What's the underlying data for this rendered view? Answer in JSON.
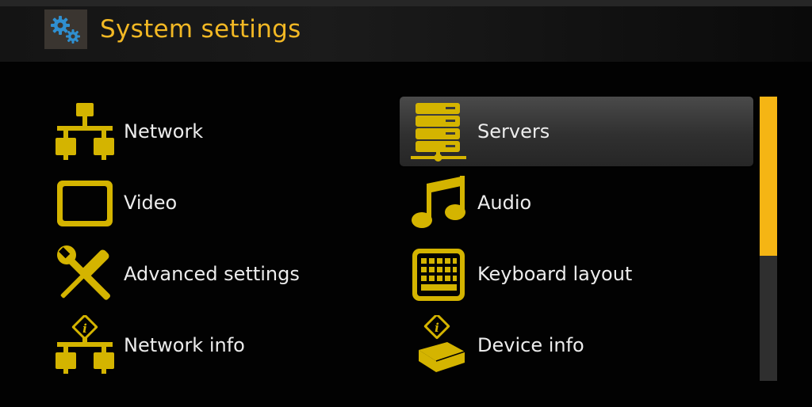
{
  "header": {
    "title": "System settings",
    "icon": "gears-icon"
  },
  "colors": {
    "accent": "#f2b824",
    "icon_yellow": "#d4b400",
    "icon_blue": "#2f8fd0",
    "label": "#ececec",
    "background": "#020202",
    "scrollbar_thumb": "#f5b514"
  },
  "menu": {
    "selected": "Servers",
    "left": [
      {
        "label": "Network",
        "icon": "network-icon"
      },
      {
        "label": "Video",
        "icon": "monitor-icon"
      },
      {
        "label": "Advanced settings",
        "icon": "tools-icon"
      },
      {
        "label": "Network info",
        "icon": "network-info-icon"
      }
    ],
    "right": [
      {
        "label": "Servers",
        "icon": "server-icon"
      },
      {
        "label": "Audio",
        "icon": "music-note-icon"
      },
      {
        "label": "Keyboard layout",
        "icon": "keyboard-icon"
      },
      {
        "label": "Device info",
        "icon": "device-info-icon"
      }
    ]
  },
  "scrollbar": {
    "position_fraction": 0,
    "visible_fraction": 0.56
  }
}
